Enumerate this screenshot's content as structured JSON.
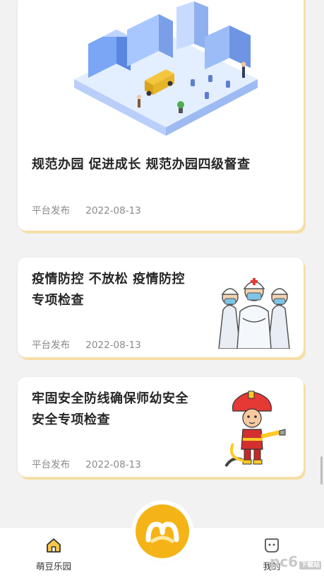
{
  "posts": [
    {
      "title": "规范办园 促进成长 规范办园四级督查",
      "source": "平台发布",
      "date": "2022-08-13",
      "image": "isometric-school-campus-illustration"
    },
    {
      "title": "疫情防控 不放松 疫情防控专项检查",
      "source": "平台发布",
      "date": "2022-08-13",
      "image": "medical-staff-illustration"
    },
    {
      "title": "牢固安全防线确保师幼安全安全专项检查",
      "source": "平台发布",
      "date": "2022-08-13",
      "image": "firefighter-kid-illustration"
    }
  ],
  "tabbar": {
    "home_label": "萌豆乐园",
    "center_icon": "mengdou-logo-icon",
    "mine_label": "我的"
  },
  "watermark": {
    "text": "pc6",
    "suffix": "下载站"
  },
  "colors": {
    "accent": "#f4b418",
    "card_shadow": "#f5dfa6",
    "meta_text": "#8a8a8a"
  }
}
